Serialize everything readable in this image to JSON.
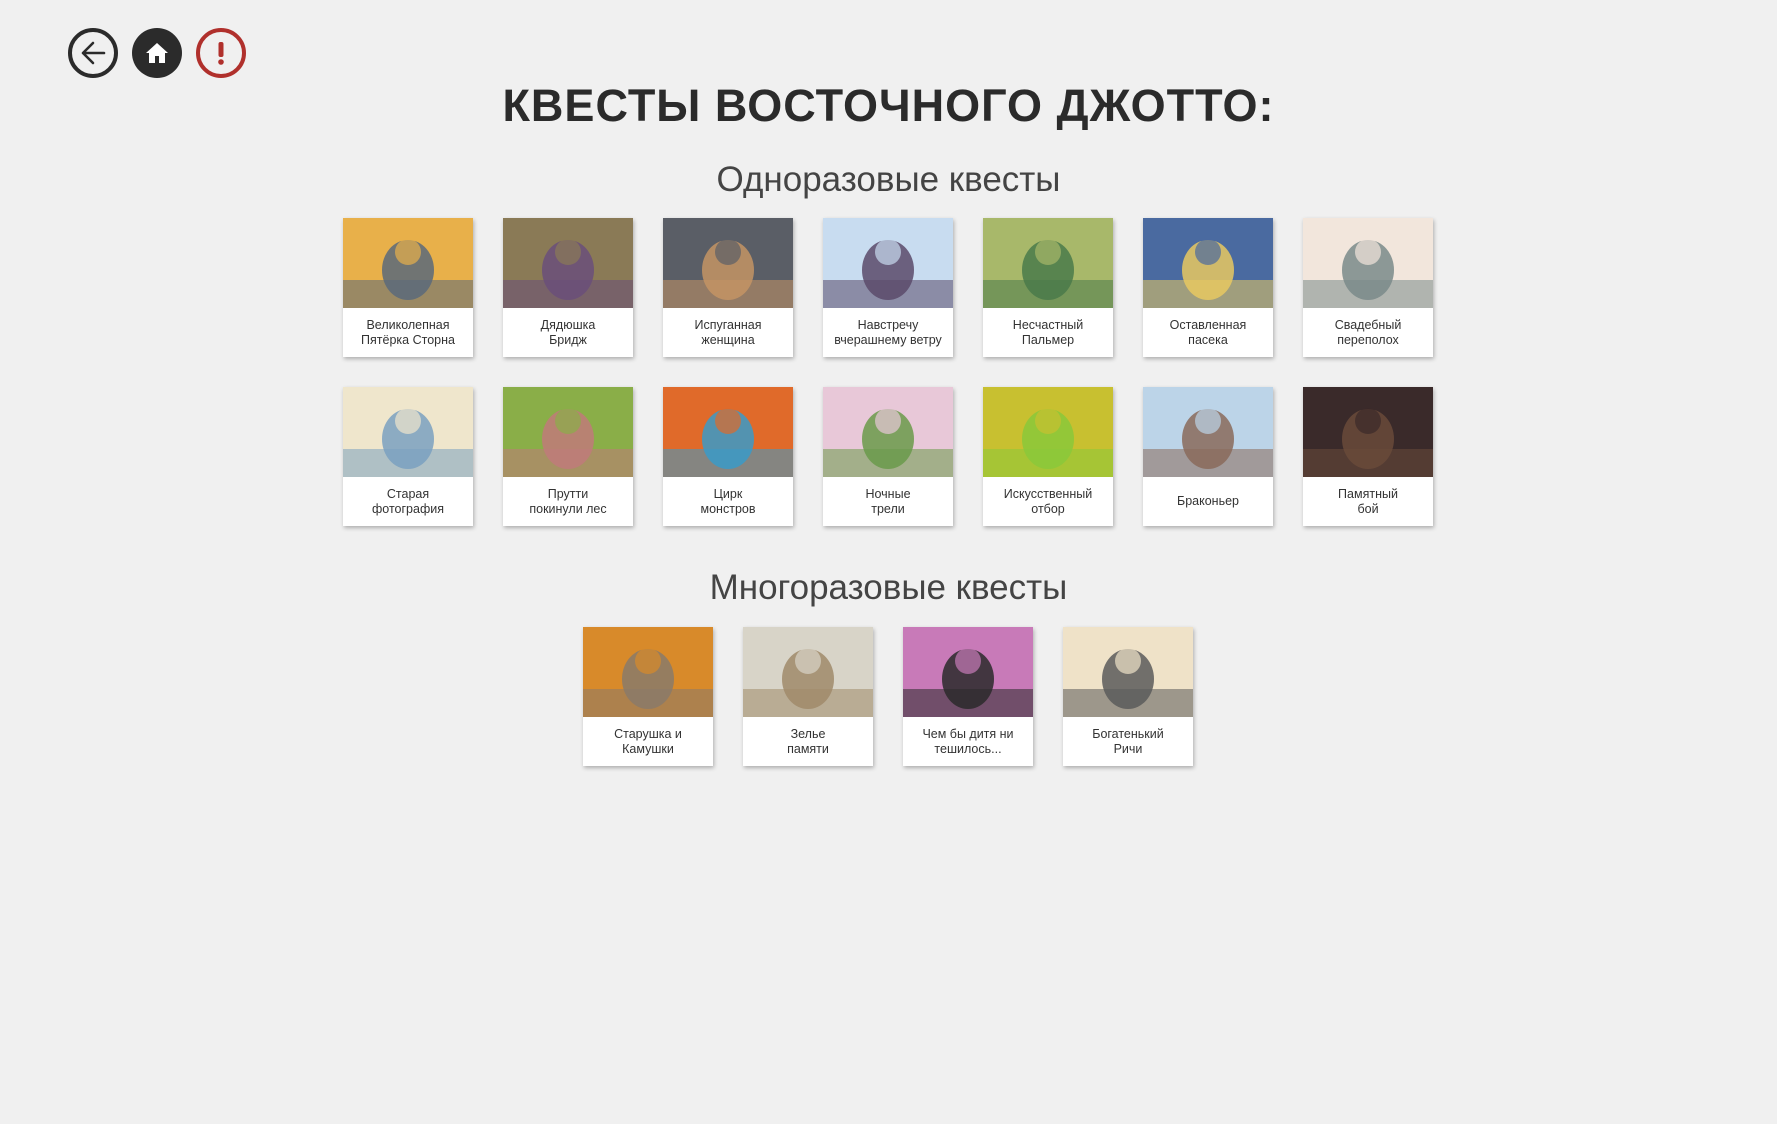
{
  "nav": {
    "back_icon": "arrow-left-icon",
    "home_icon": "home-icon",
    "report_icon": "exclamation-icon"
  },
  "title": "КВЕСТЫ ВОСТОЧНОГО ДЖОТТО:",
  "sections": {
    "one_time": {
      "title": "Одноразовые квесты",
      "quests": [
        {
          "label": "Великолепная\nПятёрка Сторна",
          "colors": [
            "#e8b04a",
            "#5a6a7a"
          ]
        },
        {
          "label": "Дядюшка\nБридж",
          "colors": [
            "#8a7a56",
            "#6a4f7a"
          ]
        },
        {
          "label": "Испуганная\nженщина",
          "colors": [
            "#5a5e66",
            "#c49464"
          ]
        },
        {
          "label": "Навстречу\nвчерашнему ветру",
          "colors": [
            "#c8dcf0",
            "#5a4a6a"
          ]
        },
        {
          "label": "Несчастный\nПальмер",
          "colors": [
            "#a8b86a",
            "#4a7a4a"
          ]
        },
        {
          "label": "Оставленная\nпасека",
          "colors": [
            "#4a6aa0",
            "#e8c860"
          ]
        },
        {
          "label": "Свадебный\nпереполох",
          "colors": [
            "#f2e6dc",
            "#7a8a8a"
          ]
        },
        {
          "label": "Старая\nфотография",
          "colors": [
            "#efe6cc",
            "#7aa0c0"
          ]
        },
        {
          "label": "Прутти\nпокинули лес",
          "colors": [
            "#8aae48",
            "#c07a7a"
          ]
        },
        {
          "label": "Цирк\nмонстров",
          "colors": [
            "#e06a2a",
            "#3a9ac8"
          ]
        },
        {
          "label": "Ночные\nтрели",
          "colors": [
            "#e8c8d8",
            "#6a9a4a"
          ]
        },
        {
          "label": "Искусственный\nотбор",
          "colors": [
            "#c8c030",
            "#8ac83a"
          ]
        },
        {
          "label": "Браконьер",
          "colors": [
            "#bcd4e8",
            "#8a6a5a"
          ]
        },
        {
          "label": "Памятный\nбой",
          "colors": [
            "#3a2a2a",
            "#6a4a3a"
          ]
        }
      ]
    },
    "repeatable": {
      "title": "Многоразовые квесты",
      "quests": [
        {
          "label": "Старушка и\nКамушки",
          "colors": [
            "#d88a2a",
            "#8a7a6a"
          ]
        },
        {
          "label": "Зелье\nпамяти",
          "colors": [
            "#d8d4c8",
            "#a08a6a"
          ]
        },
        {
          "label": "Чем бы дитя ни\nтешилось...",
          "colors": [
            "#c87ab8",
            "#2a2a2a"
          ]
        },
        {
          "label": "Богатенький\nРичи",
          "colors": [
            "#efe2c8",
            "#5a5a5a"
          ]
        }
      ]
    }
  }
}
